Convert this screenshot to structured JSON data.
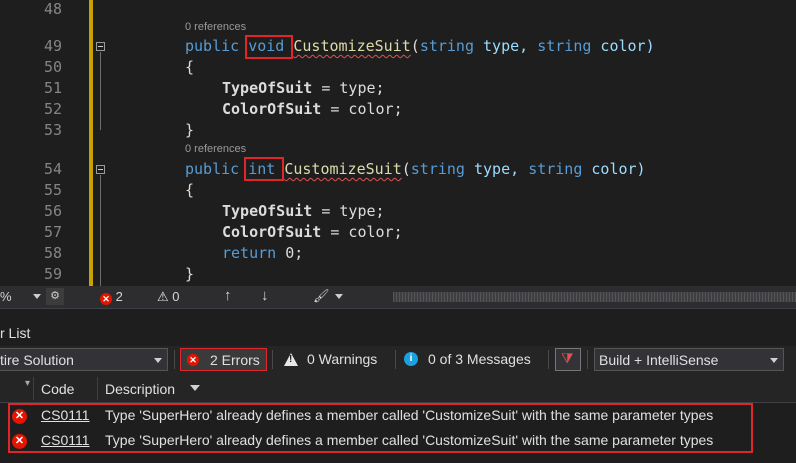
{
  "editor": {
    "line_numbers": [
      "48",
      "49",
      "50",
      "51",
      "52",
      "53",
      "54",
      "55",
      "56",
      "57",
      "58",
      "59"
    ],
    "codelens": [
      "0 references",
      "0 references"
    ],
    "method1": {
      "kw_public": "public",
      "return_type": "void",
      "name": "CustomizeSuit",
      "open_paren": "(",
      "kw_string1": "string",
      "p1": " type, ",
      "kw_string2": "string",
      "p2": " color)"
    },
    "method2": {
      "kw_public": "public",
      "return_type": "int",
      "name": "CustomizeSuit",
      "open_paren": "(",
      "kw_string1": "string",
      "p1": " type, ",
      "kw_string2": "string",
      "p2": " color)"
    },
    "brace_open": "{",
    "brace_close": "}",
    "assign_type_prop": "TypeOfSuit",
    "assign_type_rest": " = type;",
    "assign_color_prop": "ColorOfSuit",
    "assign_color_rest": " = color;",
    "return_kw": "return",
    "return_rest": " 0;"
  },
  "status_bar": {
    "zoom_fragment": "%",
    "error_count": "2",
    "warning_count": "0"
  },
  "error_list": {
    "title": "r List",
    "scope": "tire Solution",
    "errors_button": "2 Errors",
    "warnings_button": "0 Warnings",
    "messages_button": "0 of 3 Messages",
    "build_filter": "Build + IntelliSense",
    "columns": {
      "code": "Code",
      "description": "Description"
    },
    "rows": [
      {
        "code": "CS0111",
        "description": "Type 'SuperHero' already defines a member called 'CustomizeSuit' with the same parameter types"
      },
      {
        "code": "CS0111",
        "description": "Type 'SuperHero' already defines a member called 'CustomizeSuit' with the same parameter types"
      }
    ]
  },
  "colors": {
    "highlight_box": "#e0262b",
    "error": "#e51400",
    "keyword": "#569cd6",
    "method": "#dcdcaa"
  }
}
